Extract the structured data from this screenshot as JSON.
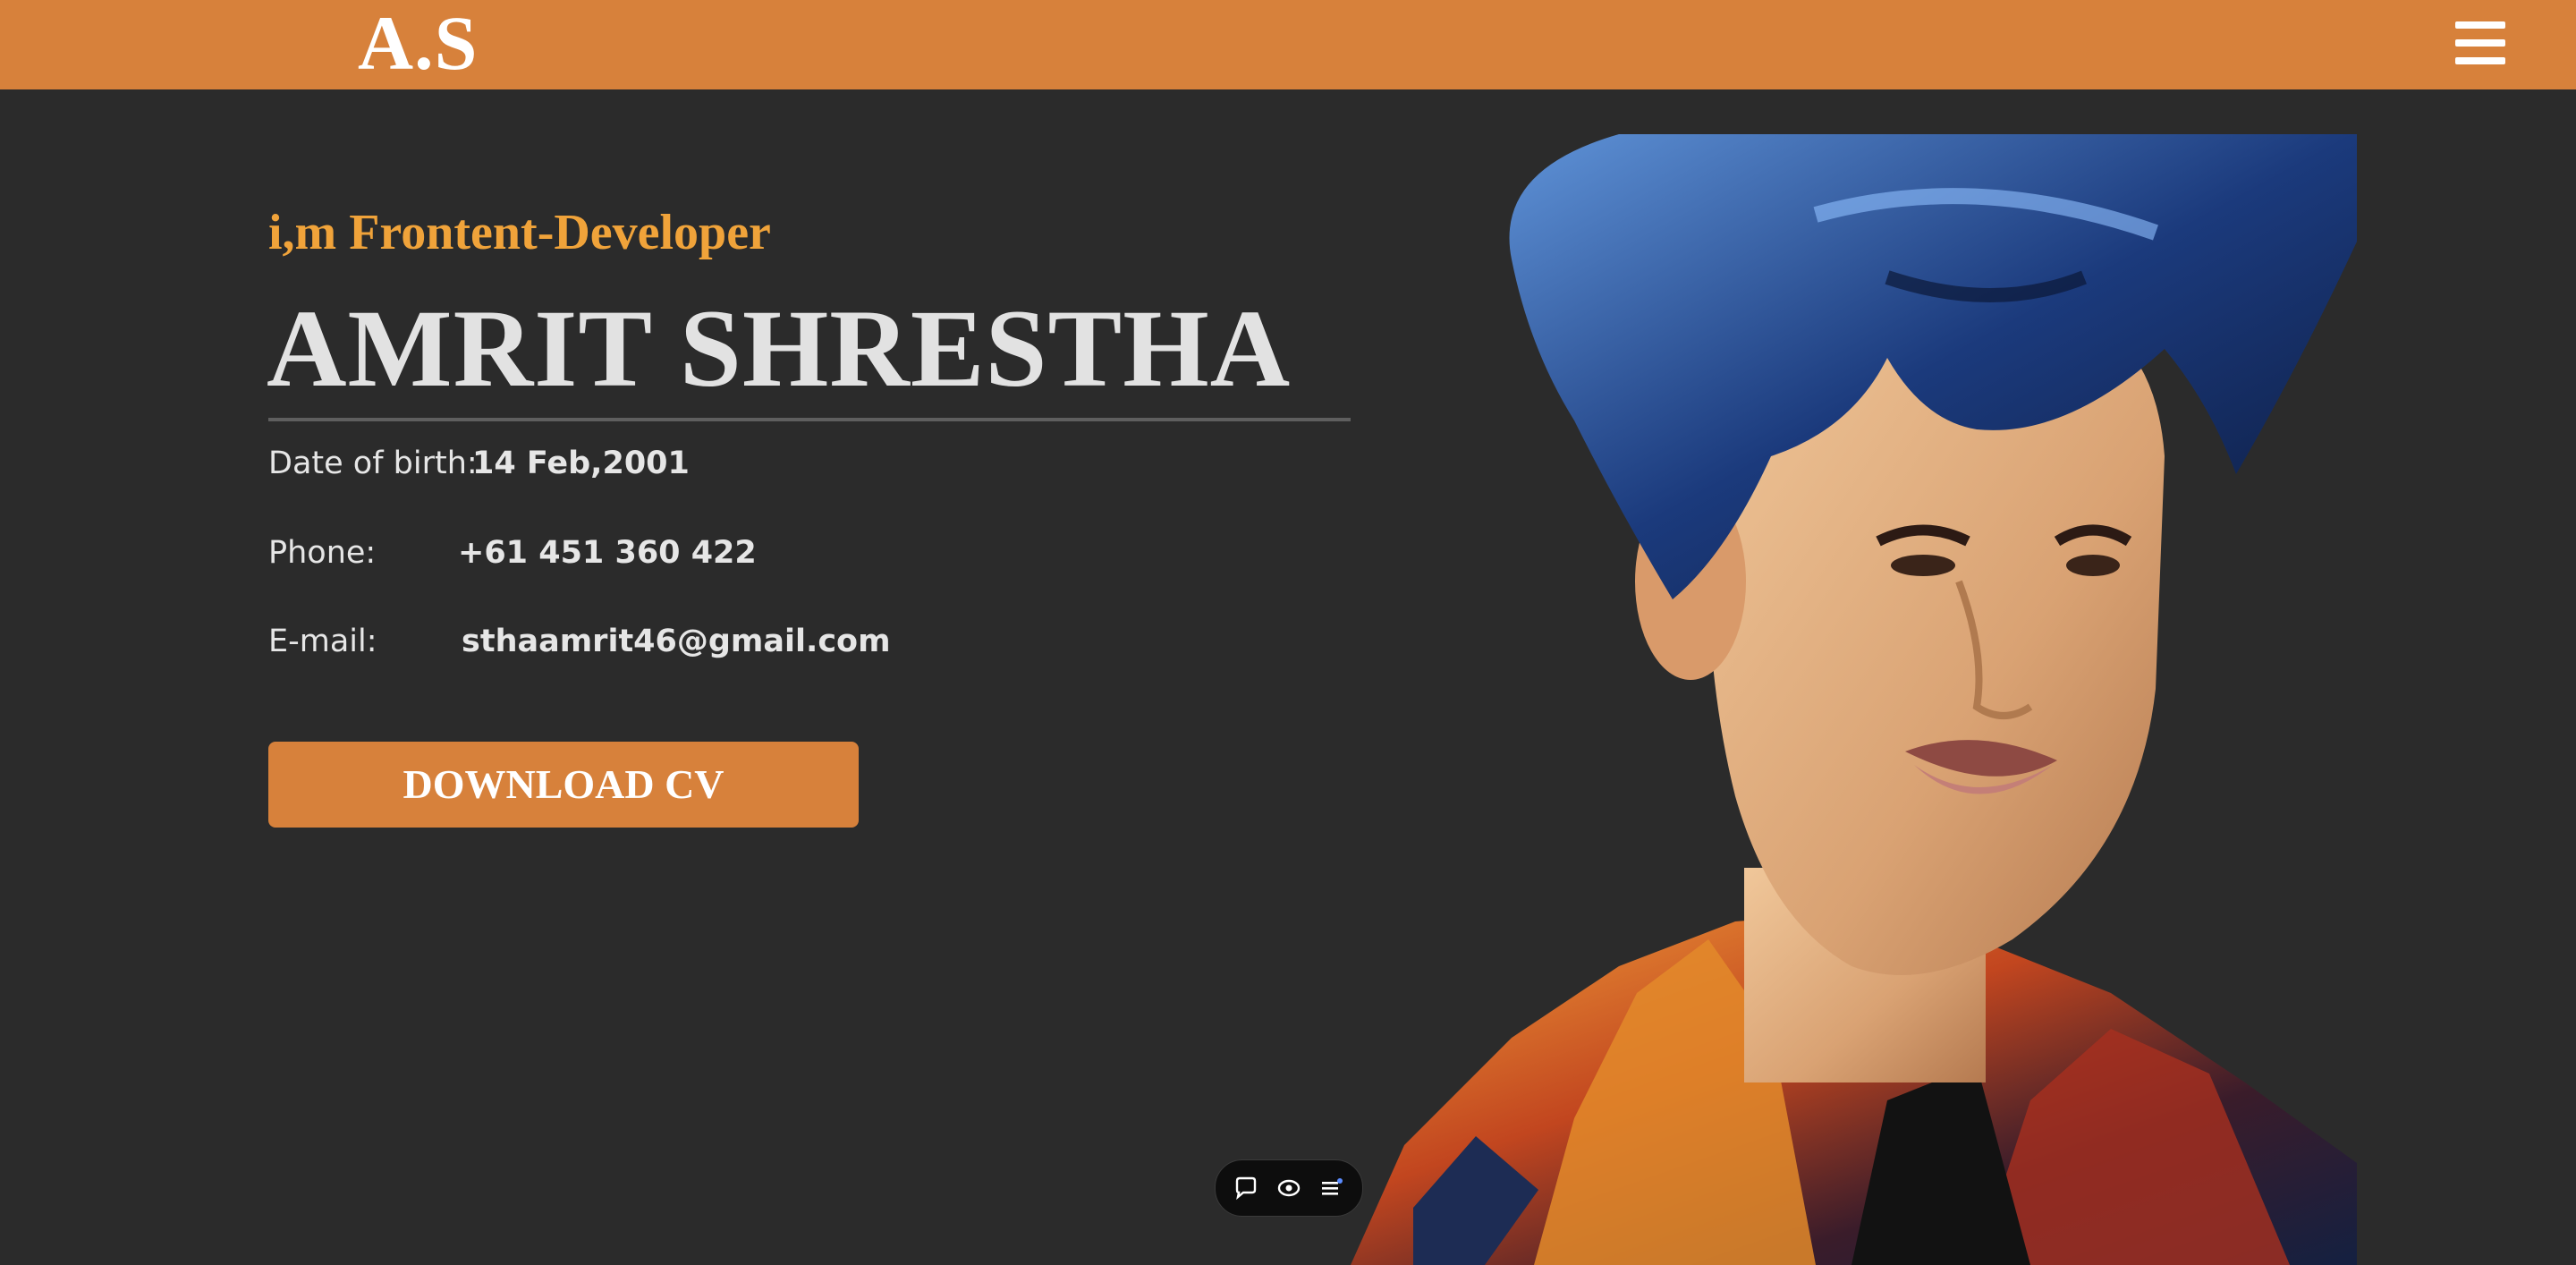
{
  "header": {
    "logo": "A.S",
    "menu_icon": "hamburger-menu-icon",
    "background_color": "#d7813b"
  },
  "hero": {
    "intro": "i,m Frontent-Developer",
    "name": "AMRIT SHRESTHA",
    "details": [
      {
        "label": "Date of birth:",
        "value": "14 Feb,2001"
      },
      {
        "label": "Phone:",
        "value": "+61 451 360 422"
      },
      {
        "label": "E-mail:",
        "value": "sthaamrit46@gmail.com"
      }
    ],
    "download_label": "DOWNLOAD CV",
    "accent_color": "#f0a33a",
    "button_color": "#d7813b"
  },
  "portrait": {
    "description_icon": "illustrated-portrait-image"
  },
  "floating_toolbar": {
    "icons": [
      "chat-bubble-icon",
      "eye-icon",
      "list-menu-icon"
    ]
  }
}
